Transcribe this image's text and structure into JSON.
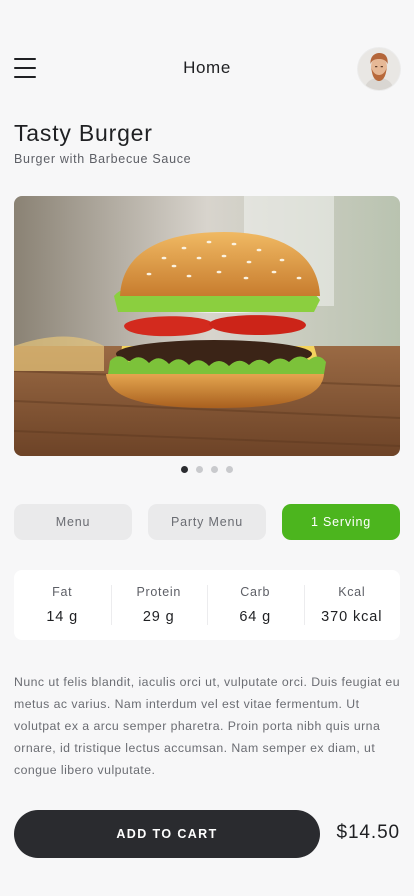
{
  "header": {
    "title": "Home",
    "menu_icon": "hamburger-menu-icon",
    "avatar_alt": "user-avatar"
  },
  "product": {
    "name": "Tasty Burger",
    "subtitle": "Burger with Barbecue Sauce",
    "image": "burger-photo",
    "carousel": {
      "count": 4,
      "active_index": 0
    }
  },
  "tabs": [
    {
      "label": "Menu",
      "active": false
    },
    {
      "label": "Party Menu",
      "active": false
    },
    {
      "label": "1 Serving",
      "active": true
    }
  ],
  "nutrition": [
    {
      "label": "Fat",
      "value": "14 g"
    },
    {
      "label": "Protein",
      "value": "29 g"
    },
    {
      "label": "Carb",
      "value": "64 g"
    },
    {
      "label": "Kcal",
      "value": "370 kcal"
    }
  ],
  "description": "Nunc ut felis blandit, iaculis orci ut, vulputate orci. Duis feugiat eu metus ac varius. Nam interdum vel est vitae fermentum. Ut volutpat ex a arcu semper pharetra. Proin porta nibh quis urna ornare, id tristique lectus accumsan. Nam semper ex diam, ut congue libero vulputate.",
  "cart": {
    "button_label": "ADD TO CART",
    "price": "$14.50"
  },
  "colors": {
    "accent": "#4cb51e",
    "dark": "#2a2b2f",
    "background": "#f7f7f8"
  }
}
